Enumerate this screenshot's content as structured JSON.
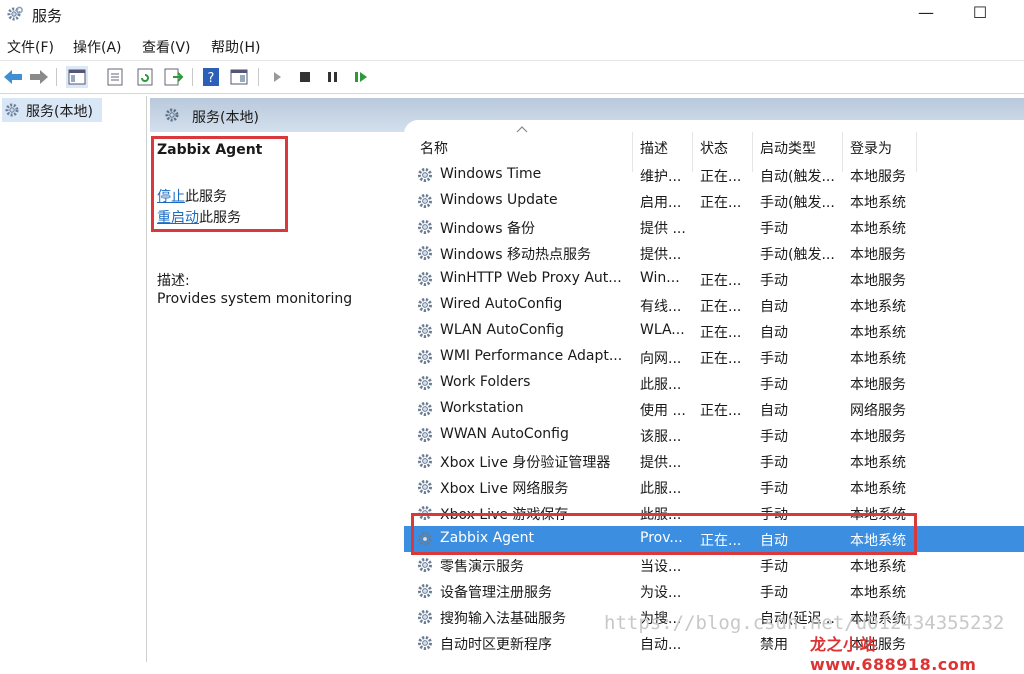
{
  "window": {
    "title": "服务",
    "minimize": "—",
    "maximize": "☐"
  },
  "menu": [
    "文件(F)",
    "操作(A)",
    "查看(V)",
    "帮助(H)"
  ],
  "tree": {
    "root": "服务(本地)"
  },
  "pane": {
    "title": "服务(本地)"
  },
  "detail": {
    "service_name": "Zabbix Agent",
    "stop_link": "停止",
    "stop_suffix": "此服务",
    "restart_link": "重启动",
    "restart_suffix": "此服务",
    "description_label": "描述:",
    "description": "Provides system monitoring"
  },
  "columns": [
    "名称",
    "描述",
    "状态",
    "启动类型",
    "登录为"
  ],
  "rows": [
    {
      "name": "Windows Time",
      "desc": "维护...",
      "status": "正在...",
      "startup": "自动(触发...",
      "logon": "本地服务"
    },
    {
      "name": "Windows Update",
      "desc": "启用...",
      "status": "正在...",
      "startup": "手动(触发...",
      "logon": "本地系统"
    },
    {
      "name": "Windows 备份",
      "desc": "提供 ...",
      "status": "",
      "startup": "手动",
      "logon": "本地系统"
    },
    {
      "name": "Windows 移动热点服务",
      "desc": "提供...",
      "status": "",
      "startup": "手动(触发...",
      "logon": "本地服务"
    },
    {
      "name": "WinHTTP Web Proxy Aut...",
      "desc": "Win...",
      "status": "正在...",
      "startup": "手动",
      "logon": "本地服务"
    },
    {
      "name": "Wired AutoConfig",
      "desc": "有线...",
      "status": "正在...",
      "startup": "自动",
      "logon": "本地系统"
    },
    {
      "name": "WLAN AutoConfig",
      "desc": "WLA...",
      "status": "正在...",
      "startup": "自动",
      "logon": "本地系统"
    },
    {
      "name": "WMI Performance Adapt...",
      "desc": "向网...",
      "status": "正在...",
      "startup": "手动",
      "logon": "本地系统"
    },
    {
      "name": "Work Folders",
      "desc": "此服...",
      "status": "",
      "startup": "手动",
      "logon": "本地服务"
    },
    {
      "name": "Workstation",
      "desc": "使用 ...",
      "status": "正在...",
      "startup": "自动",
      "logon": "网络服务"
    },
    {
      "name": "WWAN AutoConfig",
      "desc": "该服...",
      "status": "",
      "startup": "手动",
      "logon": "本地服务"
    },
    {
      "name": "Xbox Live 身份验证管理器",
      "desc": "提供...",
      "status": "",
      "startup": "手动",
      "logon": "本地系统"
    },
    {
      "name": "Xbox Live 网络服务",
      "desc": "此服...",
      "status": "",
      "startup": "手动",
      "logon": "本地系统"
    },
    {
      "name": "Xbox Live 游戏保存",
      "desc": "此服...",
      "status": "",
      "startup": "手动",
      "logon": "本地系统"
    },
    {
      "name": "Zabbix Agent",
      "desc": "Prov...",
      "status": "正在...",
      "startup": "自动",
      "logon": "本地系统"
    },
    {
      "name": "零售演示服务",
      "desc": "当设...",
      "status": "",
      "startup": "手动",
      "logon": "本地系统"
    },
    {
      "name": "设备管理注册服务",
      "desc": "为设...",
      "status": "",
      "startup": "手动",
      "logon": "本地系统"
    },
    {
      "name": "搜狗输入法基础服务",
      "desc": "为搜...",
      "status": "",
      "startup": "自动(延迟...",
      "logon": "本地系统"
    },
    {
      "name": "自动时区更新程序",
      "desc": "自动...",
      "status": "",
      "startup": "禁用",
      "logon": "本地服务"
    }
  ],
  "selected_row": 14,
  "watermark": "https://blog.csdn.net/u012434355232",
  "logo": "龙之小站 www.688918.com",
  "colors": {
    "selection": "#3c8ee0",
    "highlight_box": "#d9393a",
    "link": "#1a6cc2"
  }
}
